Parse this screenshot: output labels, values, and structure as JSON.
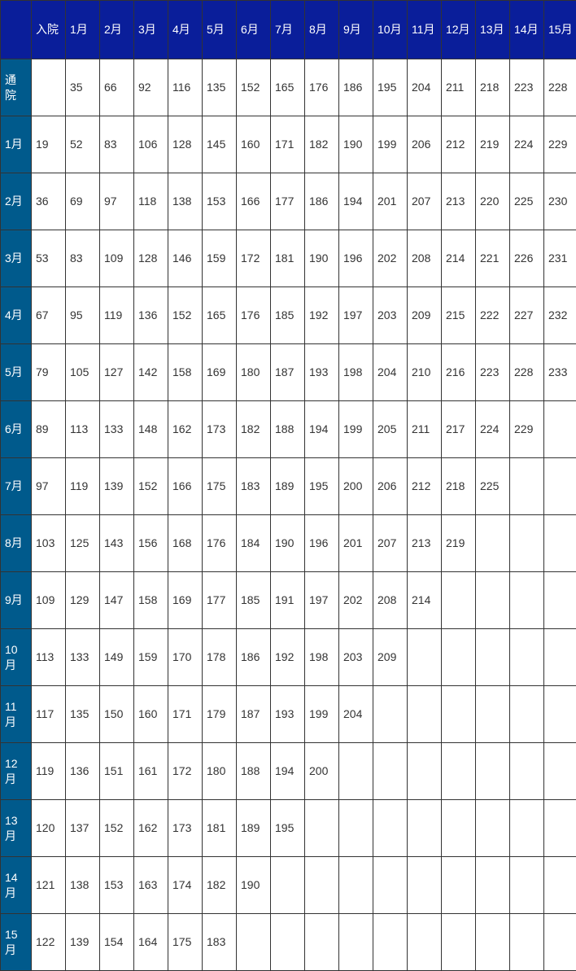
{
  "table": {
    "top_header": [
      "",
      "入院",
      "1月",
      "2月",
      "3月",
      "4月",
      "5月",
      "6月",
      "7月",
      "8月",
      "9月",
      "10月",
      "11月",
      "12月",
      "13月",
      "14月",
      "15月"
    ],
    "rows": [
      {
        "label": "通院",
        "cells": [
          "",
          "35",
          "66",
          "92",
          "116",
          "135",
          "152",
          "165",
          "176",
          "186",
          "195",
          "204",
          "211",
          "218",
          "223",
          "228"
        ]
      },
      {
        "label": "1月",
        "cells": [
          "19",
          "52",
          "83",
          "106",
          "128",
          "145",
          "160",
          "171",
          "182",
          "190",
          "199",
          "206",
          "212",
          "219",
          "224",
          "229"
        ]
      },
      {
        "label": "2月",
        "cells": [
          "36",
          "69",
          "97",
          "118",
          "138",
          "153",
          "166",
          "177",
          "186",
          "194",
          "201",
          "207",
          "213",
          "220",
          "225",
          "230"
        ]
      },
      {
        "label": "3月",
        "cells": [
          "53",
          "83",
          "109",
          "128",
          "146",
          "159",
          "172",
          "181",
          "190",
          "196",
          "202",
          "208",
          "214",
          "221",
          "226",
          "231"
        ]
      },
      {
        "label": "4月",
        "cells": [
          "67",
          "95",
          "119",
          "136",
          "152",
          "165",
          "176",
          "185",
          "192",
          "197",
          "203",
          "209",
          "215",
          "222",
          "227",
          "232"
        ]
      },
      {
        "label": "5月",
        "cells": [
          "79",
          "105",
          "127",
          "142",
          "158",
          "169",
          "180",
          "187",
          "193",
          "198",
          "204",
          "210",
          "216",
          "223",
          "228",
          "233"
        ]
      },
      {
        "label": "6月",
        "cells": [
          "89",
          "113",
          "133",
          "148",
          "162",
          "173",
          "182",
          "188",
          "194",
          "199",
          "205",
          "211",
          "217",
          "224",
          "229",
          ""
        ]
      },
      {
        "label": "7月",
        "cells": [
          "97",
          "119",
          "139",
          "152",
          "166",
          "175",
          "183",
          "189",
          "195",
          "200",
          "206",
          "212",
          "218",
          "225",
          "",
          ""
        ]
      },
      {
        "label": "8月",
        "cells": [
          "103",
          "125",
          "143",
          "156",
          "168",
          "176",
          "184",
          "190",
          "196",
          "201",
          "207",
          "213",
          "219",
          "",
          "",
          ""
        ]
      },
      {
        "label": "9月",
        "cells": [
          "109",
          "129",
          "147",
          "158",
          "169",
          "177",
          "185",
          "191",
          "197",
          "202",
          "208",
          "214",
          "",
          "",
          "",
          ""
        ]
      },
      {
        "label": "10月",
        "cells": [
          "113",
          "133",
          "149",
          "159",
          "170",
          "178",
          "186",
          "192",
          "198",
          "203",
          "209",
          "",
          "",
          "",
          "",
          ""
        ]
      },
      {
        "label": "11月",
        "cells": [
          "117",
          "135",
          "150",
          "160",
          "171",
          "179",
          "187",
          "193",
          "199",
          "204",
          "",
          "",
          "",
          "",
          "",
          ""
        ]
      },
      {
        "label": "12月",
        "cells": [
          "119",
          "136",
          "151",
          "161",
          "172",
          "180",
          "188",
          "194",
          "200",
          "",
          "",
          "",
          "",
          "",
          "",
          ""
        ]
      },
      {
        "label": "13月",
        "cells": [
          "120",
          "137",
          "152",
          "162",
          "173",
          "181",
          "189",
          "195",
          "",
          "",
          "",
          "",
          "",
          "",
          "",
          ""
        ]
      },
      {
        "label": "14月",
        "cells": [
          "121",
          "138",
          "153",
          "163",
          "174",
          "182",
          "190",
          "",
          "",
          "",
          "",
          "",
          "",
          "",
          "",
          ""
        ]
      },
      {
        "label": "15月",
        "cells": [
          "122",
          "139",
          "154",
          "164",
          "175",
          "183",
          "",
          "",
          "",
          "",
          "",
          "",
          "",
          "",
          "",
          ""
        ]
      }
    ]
  }
}
